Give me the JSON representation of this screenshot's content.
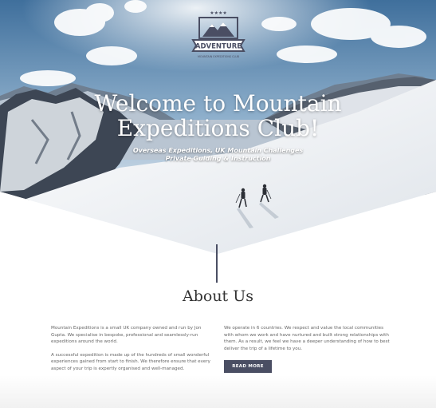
{
  "hero": {
    "title_line1": "Welcome to Mountain",
    "title_line2": "Expeditions Club!",
    "subtitle_line1": "Overseas Expeditions, UK Mountain Challenges",
    "subtitle_line2": "Private Guiding & Instruction"
  },
  "logo": {
    "text": "ADVENTURE",
    "tagline": "MOUNTAIN EXPEDITIONS CLUB",
    "stars": "★★★★",
    "color": "#4a4e63"
  },
  "about": {
    "title": "About Us",
    "left_paragraph_1": "Mountain Expeditions is a small UK company owned and run by Jon Gupta. We specialise in bespoke, professional and seamlessly-run expeditions around the world.",
    "left_paragraph_2": "A successful expedition is made up of the hundreds of small wonderful experiences gained from start to finish. We therefore ensure that every aspect of your trip is expertly organised and well-managed.",
    "right_paragraph_1": "We operate in 6 countries. We respect and value the local communities with whom we work and have nurtured and built strong relationships with them. As a result, we feel we have a deeper understanding of how to best deliver the trip of a lifetime to you.",
    "button_label": "READ MORE"
  },
  "colors": {
    "accent": "#4a4e63",
    "sky_top": "#3f6f9c",
    "snow": "#eef1f5"
  }
}
